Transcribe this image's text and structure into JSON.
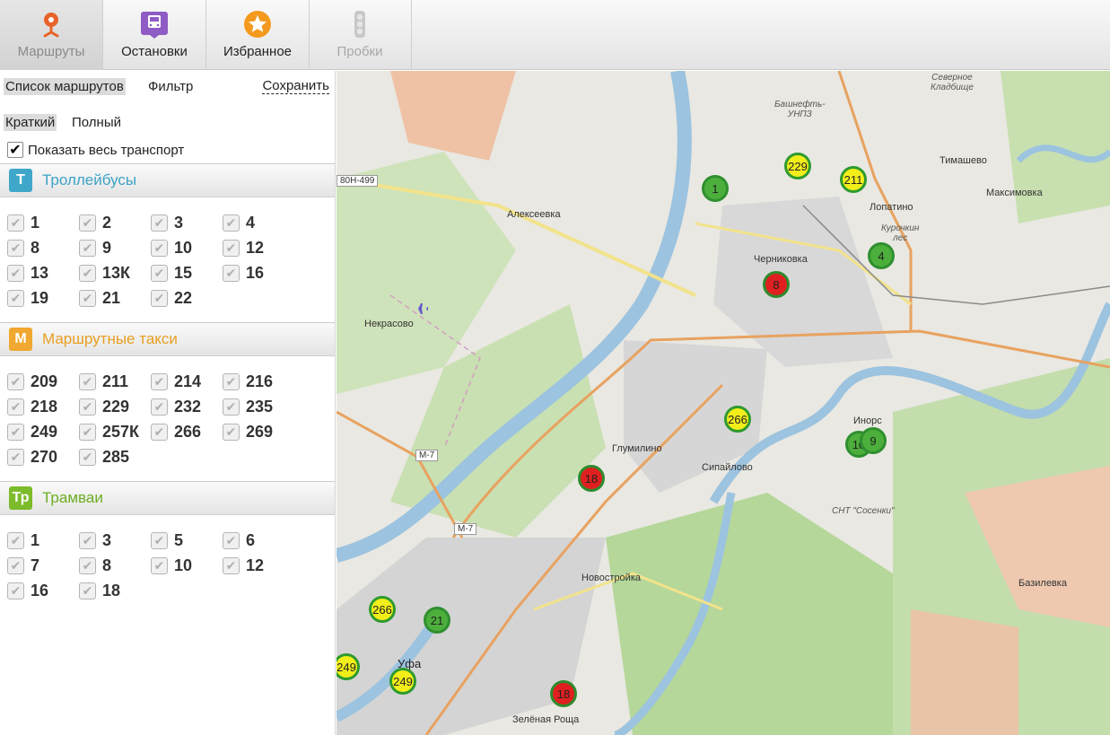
{
  "toolbar": {
    "buttons": [
      {
        "label": "Маршруты",
        "icon": "route-pin-icon"
      },
      {
        "label": "Остановки",
        "icon": "bus-stop-icon"
      },
      {
        "label": "Избранное",
        "icon": "star-icon"
      },
      {
        "label": "Пробки",
        "icon": "traffic-light-icon"
      }
    ]
  },
  "sidebar": {
    "tab_list": "Список маршрутов",
    "tab_filter": "Фильтр",
    "save_link": "Сохранить",
    "mode_short": "Краткий",
    "mode_full": "Полный",
    "show_all_label": "Показать весь транспорт",
    "sections": [
      {
        "badge": "Т",
        "title": "Троллейбусы",
        "color": "#3fa7c9",
        "routes": [
          "1",
          "2",
          "3",
          "4",
          "8",
          "9",
          "10",
          "12",
          "13",
          "13К",
          "15",
          "16",
          "19",
          "21",
          "22"
        ]
      },
      {
        "badge": "М",
        "title": "Маршрутные такси",
        "color": "#f0a830",
        "routes": [
          "209",
          "211",
          "214",
          "216",
          "218",
          "229",
          "232",
          "235",
          "249",
          "257К",
          "266",
          "269",
          "270",
          "285"
        ]
      },
      {
        "badge": "Тр",
        "title": "Трамваи",
        "color": "#7cbb2a",
        "routes": [
          "1",
          "3",
          "5",
          "6",
          "7",
          "8",
          "10",
          "12",
          "16",
          "18"
        ]
      }
    ]
  },
  "map": {
    "places": {
      "severnoe": "Северное\nКладбище",
      "bashneft": "Башнефть-\nУНПЗ",
      "timashevo": "Тимашево",
      "maksimovka": "Максимовка",
      "lopatino": "Лопатино",
      "kurochkin": "Курочкин\nлес",
      "alekseevka": "Алексеевка",
      "chernikovka": "Черниковка",
      "nekrasovo": "Некрасово",
      "inors": "Инорс",
      "glumilino": "Глумилино",
      "sipaylovo": "Сипайлово",
      "snt": "СНТ \"Сосенки\"",
      "novostroyka": "Новостройка",
      "bazilevka": "Базилевка",
      "ufa": "Уфа",
      "zelenaya": "Зелёная Роща"
    },
    "roads": {
      "r1": "80Н-499",
      "r2": "М-7",
      "r3": "М-7"
    },
    "markers": [
      {
        "label": "1",
        "kind": "green"
      },
      {
        "label": "229",
        "kind": "yellow"
      },
      {
        "label": "211",
        "kind": "yellow"
      },
      {
        "label": "4",
        "kind": "green"
      },
      {
        "label": "8",
        "kind": "red"
      },
      {
        "label": "266",
        "kind": "yellow"
      },
      {
        "label": "10",
        "kind": "green"
      },
      {
        "label": "9",
        "kind": "green"
      },
      {
        "label": "18",
        "kind": "red"
      },
      {
        "label": "266",
        "kind": "yellow"
      },
      {
        "label": "21",
        "kind": "green"
      },
      {
        "label": "249",
        "kind": "yellow"
      },
      {
        "label": "249",
        "kind": "yellow"
      },
      {
        "label": "18",
        "kind": "red"
      }
    ]
  }
}
